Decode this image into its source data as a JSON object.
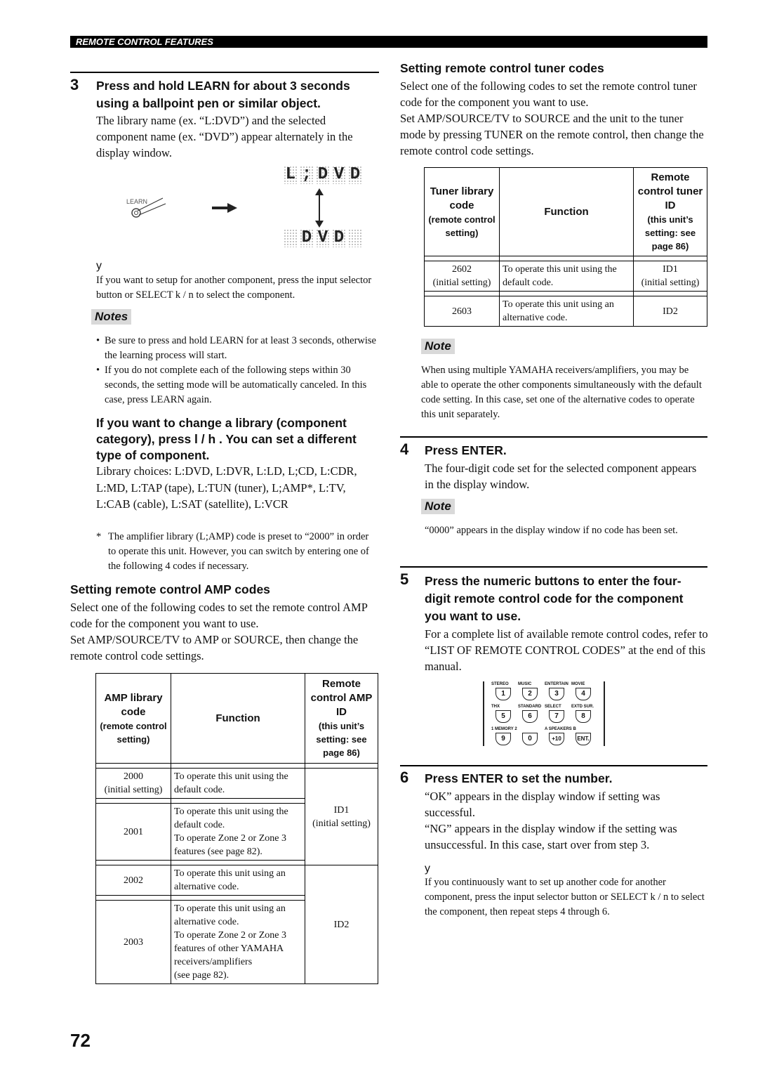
{
  "header": "REMOTE CONTROL FEATURES",
  "step3": {
    "num": "3",
    "title": "Press and hold LEARN for about 3 seconds using a ballpoint pen or similar object.",
    "text": "The library name (ex. “L:DVD”) and the selected component name (ex. “DVD”) appear alternately in the display window.",
    "learn_label": "LEARN",
    "display_top": [
      "L",
      ";",
      "D",
      "V",
      "D"
    ],
    "display_bottom": [
      "",
      "D",
      "V",
      "D",
      ""
    ],
    "tip_icon": "y",
    "tip": "If you want to setup for another component, press the input selector button or SELECT k / n to select the component."
  },
  "notes1": {
    "title": "Notes",
    "items": [
      "Be sure to press and hold LEARN for at least 3 seconds, otherwise the learning process will start.",
      "If you do not complete each of the following steps within 30 seconds, the setting mode will be automatically canceled. In this case, press LEARN again."
    ]
  },
  "library": {
    "title": "If you want to change a library (component category), press l / h . You can set a different type of component.",
    "choices": "Library choices: L:DVD, L:DVR, L:LD, L;CD, L:CDR, L:MD, L:TAP (tape), L:TUN (tuner), L;AMP*, L:TV, L:CAB (cable), L:SAT (satellite), L:VCR",
    "footnote_mark": "*",
    "footnote": "The amplifier library (L;AMP) code is preset to “2000” in order to operate this unit. However, you can switch by entering one of the following 4 codes if necessary."
  },
  "amp": {
    "title": "Setting remote control AMP codes",
    "p1": "Select one of the following codes to set the remote control AMP code for the component you want to use.",
    "p2": "Set AMP/SOURCE/TV to AMP or SOURCE, then change the remote control code settings.",
    "headers": {
      "c1": "AMP library code",
      "c1sub": "(remote control setting)",
      "c2": "Function",
      "c3": "Remote control AMP ID",
      "c3sub": "(this unit’s setting: see page 86)"
    },
    "rows": [
      {
        "code": "2000\n(initial setting)",
        "func": "To operate this unit using the default code."
      },
      {
        "code": "2001",
        "func": "To operate this unit using the default code.\nTo operate Zone 2 or Zone 3 features (see page 82)."
      },
      {
        "code": "2002",
        "func": "To operate this unit using an alternative code."
      },
      {
        "code": "2003",
        "func": "To operate this unit using an alternative code.\nTo operate Zone 2 or Zone 3 features of other YAMAHA receivers/amplifiers\n(see page 82)."
      }
    ],
    "ids": [
      "ID1\n(initial setting)",
      "ID2"
    ]
  },
  "tuner": {
    "title": "Setting remote control tuner codes",
    "p1": "Select one of the following codes to set the remote control tuner code for the component you want to use.",
    "p2": "Set AMP/SOURCE/TV to SOURCE and the unit to the tuner mode by pressing TUNER on the remote control, then change the remote control code settings.",
    "headers": {
      "c1": "Tuner library code",
      "c1sub": "(remote control setting)",
      "c2": "Function",
      "c3": "Remote control tuner ID",
      "c3sub": "(this unit’s setting: see page 86)"
    },
    "rows": [
      {
        "code": "2602\n(initial setting)",
        "func": "To operate this unit using the default code.",
        "id": "ID1\n(initial setting)"
      },
      {
        "code": "2603",
        "func": "To operate this unit using an alternative code.",
        "id": "ID2"
      }
    ]
  },
  "note2": {
    "title": "Note",
    "text": "When using multiple YAMAHA receivers/amplifiers, you may be able to operate the other components simultaneously with the default code setting. In this case, set one of the alternative codes to operate this unit separately."
  },
  "step4": {
    "num": "4",
    "title": "Press ENTER.",
    "text": "The four-digit code set for the selected component appears in the display window.",
    "note_title": "Note",
    "note": "“0000” appears in the display window if no code has been set."
  },
  "step5": {
    "num": "5",
    "title": "Press the numeric buttons to enter the four-digit remote control code for the component you want to use.",
    "text": "For a complete list of available remote control codes, refer to “LIST OF REMOTE CONTROL CODES” at the end of this manual.",
    "keys": [
      {
        "label": "STEREO",
        "key": "1"
      },
      {
        "label": "MUSIC",
        "key": "2"
      },
      {
        "label": "ENTERTAIN",
        "key": "3"
      },
      {
        "label": "MOVIE",
        "key": "4"
      },
      {
        "label": "THX",
        "key": "5"
      },
      {
        "label": "STANDARD",
        "key": "6"
      },
      {
        "label": "SELECT",
        "key": "7"
      },
      {
        "label": "EXTD SUR.",
        "key": "8"
      },
      {
        "label": "1  MEMORY  2",
        "key": "9"
      },
      {
        "label": "",
        "key": "0"
      },
      {
        "label": "A  SPEAKERS B",
        "key": "+10"
      },
      {
        "label": "",
        "key": "ENT."
      }
    ]
  },
  "step6": {
    "num": "6",
    "title": "Press ENTER to set the number.",
    "p1": "“OK” appears in the display window if setting was successful.",
    "p2": "“NG” appears in the display window if the setting was unsuccessful. In this case, start over from step 3.",
    "tip_icon": "y",
    "tip": "If you continuously want to set up another code for another component, press the input selector button or SELECT k / n to select the component, then repeat steps 4 through 6."
  },
  "page_number": "72"
}
